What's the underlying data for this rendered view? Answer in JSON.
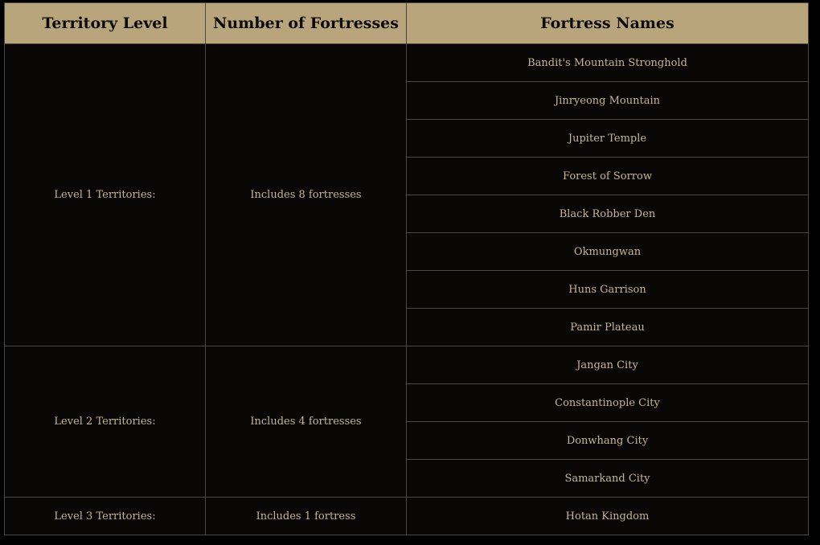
{
  "table": {
    "headers": [
      "Territory Level",
      "Number of Fortresses",
      "Fortress Names"
    ],
    "groups": [
      {
        "level": "Level 1 Territories:",
        "count": "Includes 8 fortresses",
        "fortresses": [
          "Bandit's Mountain Stronghold",
          "Jinryeong Mountain",
          "Jupiter Temple",
          "Forest of Sorrow",
          "Black Robber Den",
          "Okmungwan",
          "Huns Garrison",
          "Pamir Plateau"
        ]
      },
      {
        "level": "Level 2 Territories:",
        "count": "Includes 4 fortresses",
        "fortresses": [
          "Jangan City",
          "Constantinople City",
          "Donwhang City",
          "Samarkand City"
        ]
      },
      {
        "level": "Level 3 Territories:",
        "count": "Includes 1 fortress",
        "fortresses": [
          "Hotan Kingdom"
        ]
      }
    ]
  },
  "colors": {
    "header_bg": "#b8a57b",
    "header_text": "#0b0b0b",
    "body_bg": "#080706",
    "body_text": "#c8b592",
    "border": "#4b4843"
  }
}
